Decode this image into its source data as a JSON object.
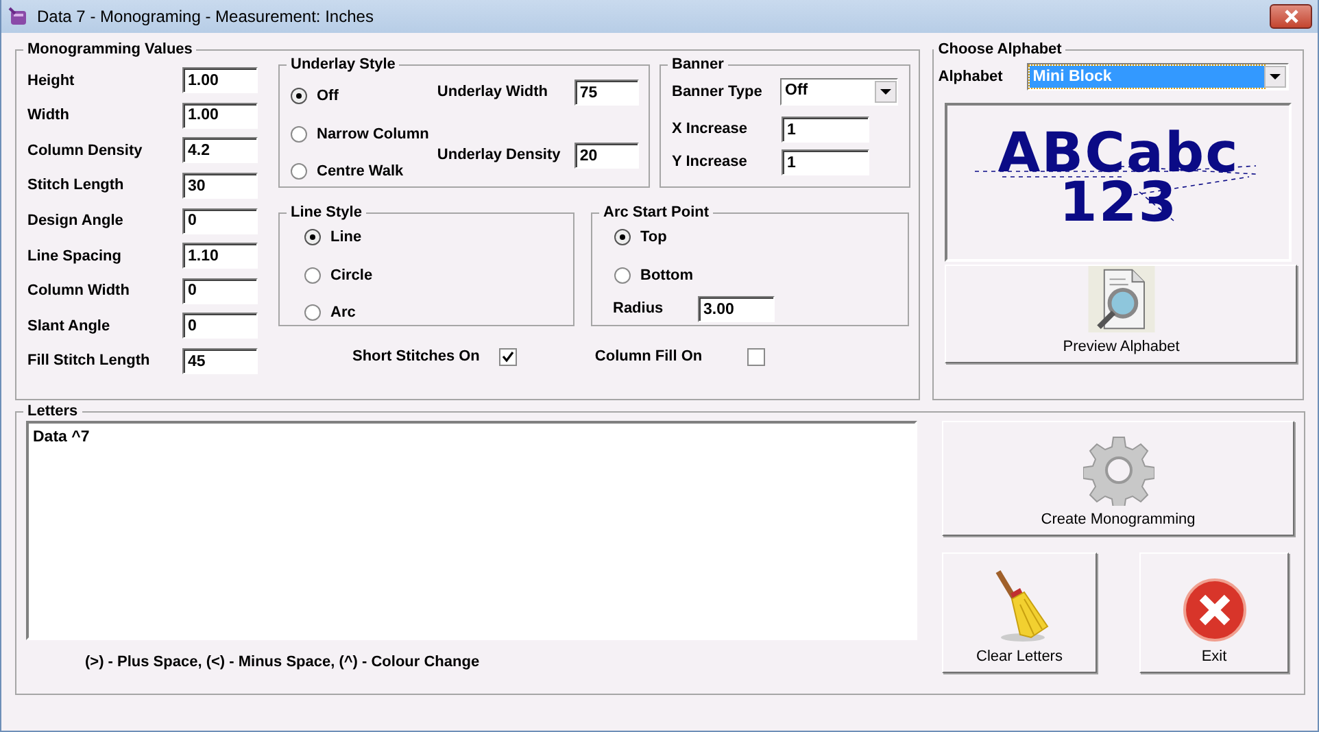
{
  "window": {
    "title": "Data 7 - Monograming - Measurement: Inches"
  },
  "monogramming_values": {
    "title": "Monogramming Values",
    "fields": [
      {
        "label": "Height",
        "value": "1.00"
      },
      {
        "label": "Width",
        "value": "1.00"
      },
      {
        "label": "Column Density",
        "value": "4.2"
      },
      {
        "label": "Stitch Length",
        "value": "30"
      },
      {
        "label": "Design Angle",
        "value": "0"
      },
      {
        "label": "Line Spacing",
        "value": "1.10"
      },
      {
        "label": "Column Width",
        "value": "0"
      },
      {
        "label": "Slant Angle",
        "value": "0"
      },
      {
        "label": "Fill Stitch Length",
        "value": "45"
      }
    ]
  },
  "underlay_style": {
    "title": "Underlay Style",
    "options": [
      {
        "label": "Off",
        "selected": true
      },
      {
        "label": "Narrow Column",
        "selected": false
      },
      {
        "label": "Centre Walk",
        "selected": false
      }
    ],
    "underlay_width": {
      "label": "Underlay Width",
      "value": "75"
    },
    "underlay_density": {
      "label": "Underlay Density",
      "value": "20"
    }
  },
  "banner": {
    "title": "Banner",
    "banner_type": {
      "label": "Banner Type",
      "value": "Off"
    },
    "x_increase": {
      "label": "X Increase",
      "value": "1"
    },
    "y_increase": {
      "label": "Y Increase",
      "value": "1"
    }
  },
  "line_style": {
    "title": "Line Style",
    "options": [
      {
        "label": "Line",
        "selected": true
      },
      {
        "label": "Circle",
        "selected": false
      },
      {
        "label": "Arc",
        "selected": false
      }
    ]
  },
  "arc_start_point": {
    "title": "Arc Start Point",
    "options": [
      {
        "label": "Top",
        "selected": true
      },
      {
        "label": "Bottom",
        "selected": false
      }
    ],
    "radius": {
      "label": "Radius",
      "value": "3.00"
    }
  },
  "checkboxes": [
    {
      "label": "Short Stitches On",
      "checked": true
    },
    {
      "label": "Column Fill On",
      "checked": false
    }
  ],
  "choose_alphabet": {
    "title": "Choose Alphabet",
    "alphabet": {
      "label": "Alphabet",
      "value": "Mini Block"
    },
    "preview_lines": [
      "ABCabc",
      "123"
    ],
    "preview_button": "Preview Alphabet"
  },
  "letters": {
    "title": "Letters",
    "text": "Data ^7",
    "hint": "(>) - Plus Space, (<) - Minus Space, (^) - Colour Change"
  },
  "buttons": [
    {
      "label": "Create Monogramming",
      "kind": "gear"
    },
    {
      "label": "Clear Letters",
      "kind": "broom"
    },
    {
      "label": "Exit",
      "kind": "exit"
    }
  ]
}
